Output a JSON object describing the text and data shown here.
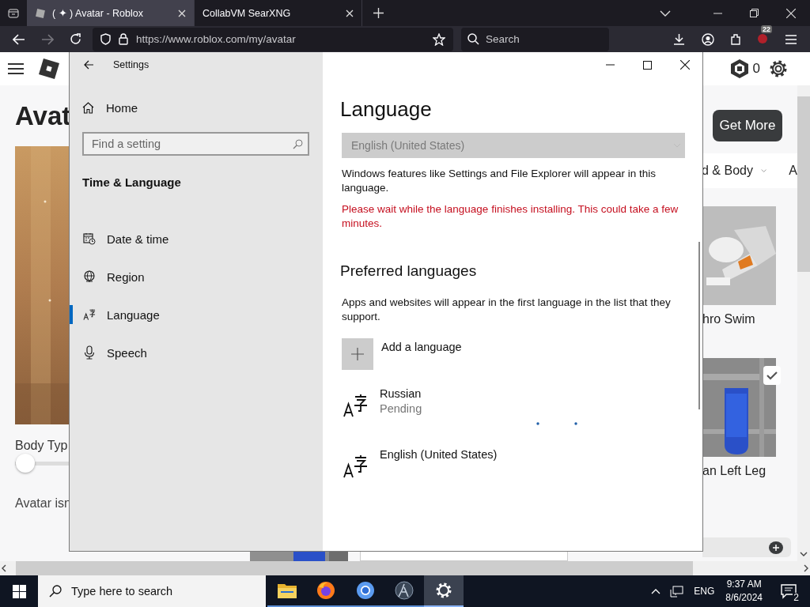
{
  "browser": {
    "tabs": [
      {
        "title": "( ✦ ) Avatar - Roblox",
        "selected": true
      },
      {
        "title": "CollabVM SearXNG",
        "selected": false
      }
    ],
    "url": "https://www.roblox.com/my/avatar",
    "search": {
      "placeholder": "Search"
    },
    "extension_badge": "22"
  },
  "roblox": {
    "heading": "Avat",
    "body_type_label": "Body Typ",
    "body_type_slider": {
      "level": 0
    },
    "notice": "Avatar isn",
    "robux": "0",
    "get_more": "Get More",
    "category_tabs": [
      "d & Body",
      "A"
    ],
    "items": [
      {
        "name": "hro Swim",
        "selected": false
      },
      {
        "name": "an Left Leg",
        "selected": true
      }
    ]
  },
  "settings": {
    "title": "Settings",
    "home": "Home",
    "search": {
      "placeholder": "Find a setting"
    },
    "section": "Time & Language",
    "nav": [
      {
        "label": "Date & time",
        "selected": false
      },
      {
        "label": "Region",
        "selected": false
      },
      {
        "label": "Language",
        "selected": true
      },
      {
        "label": "Speech",
        "selected": false
      }
    ],
    "page_title": "Language",
    "language_dropdown": {
      "value": "English (United States)",
      "disabled": true
    },
    "dropdown_description": "Windows features like Settings and File Explorer will appear in this language.",
    "warning": "Please wait while the language finishes installing. This could take a few minutes.",
    "preferred_heading": "Preferred languages",
    "preferred_description": "Apps and websites will appear in the first language in the list that they support.",
    "add_language": "Add a language",
    "languages": [
      {
        "name": "Russian",
        "status": "Pending",
        "installing": true
      },
      {
        "name": "English (United States)",
        "installing": false
      }
    ]
  },
  "taskbar": {
    "search": {
      "placeholder": "Type here to search"
    },
    "apps": [
      {
        "kind": "files",
        "selected": false
      },
      {
        "kind": "firefox",
        "selected": false
      },
      {
        "kind": "chromium",
        "selected": false
      },
      {
        "kind": "game",
        "selected": false
      },
      {
        "kind": "settings",
        "selected": true
      }
    ],
    "language": "ENG",
    "time": "9:37 AM",
    "date": "8/6/2024",
    "notifications": "2"
  }
}
